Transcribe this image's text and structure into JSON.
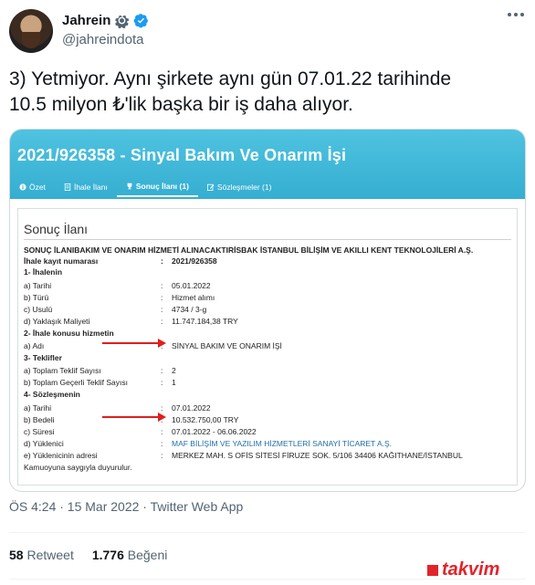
{
  "author": {
    "name": "Jahrein",
    "handle": "@jahreindota"
  },
  "tweet": {
    "line1": "3) Yetmiyor. Aynı şirkete aynı gün 07.01.22 tarihinde",
    "line2": "10.5 milyon ₺'lik başka bir iş daha alıyor.",
    "timestamp": "ÖS 4:24 · 15 Mar 2022 · Twitter Web App"
  },
  "stats": {
    "retweets_count": "58",
    "retweets_label": "Retweet",
    "likes_count": "1.776",
    "likes_label": "Beğeni"
  },
  "ihale": {
    "title": "2021/926358 - Sinyal Bakım Ve Onarım İşi",
    "tabs": [
      "Özet",
      "İhale İlanı",
      "Sonuç İlanı (1)",
      "Sözleşmeler (1)"
    ],
    "doc_title": "Sonuç İlanı",
    "header_line": "SONUÇ İLANIBAKIM VE ONARIM HİZMETİ ALINACAKTIRİSBAK İSTANBUL BİLİŞİM VE AKILLI KENT TEKNOLOJİLERİ A.Ş.",
    "kayit_label": "İhale kayıt numarası",
    "kayit_value": "2021/926358",
    "sec1": "1- İhalenin",
    "tarih_label": "a) Tarihi",
    "tarih_value": "05.01.2022",
    "turu_label": "b) Türü",
    "turu_value": "Hizmet alımı",
    "usulu_label": "c) Usulü",
    "usulu_value": "4734 / 3-g",
    "maliyet_label": "d) Yaklaşık Maliyeti",
    "maliyet_value": "11.747.184,38 TRY",
    "sec2": "2- İhale konusu hizmetin",
    "adi_label": "a) Adı",
    "adi_value": "SİNYAL BAKIM VE ONARIM İŞİ",
    "sec3": "3- Teklifler",
    "teklif_label": "a) Toplam Teklif Sayısı",
    "teklif_value": "2",
    "gecerli_label": "b) Toplam Geçerli Teklif Sayısı",
    "gecerli_value": "1",
    "sec4": "4- Sözleşmenin",
    "s_tarih_label": "a) Tarihi",
    "s_tarih_value": "07.01.2022",
    "bedel_label": "b) Bedeli",
    "bedel_value": "10.532.750,00 TRY",
    "suresi_label": "c) Süresi",
    "suresi_value": "07.01.2022 - 06.06.2022",
    "yuklenici_label": "d) Yüklenici",
    "yuklenici_value": "MAF BİLİŞİM VE YAZILIM HİZMETLERİ SANAYİ TİCARET A.Ş.",
    "adres_label": "e) Yüklenicinin adresi",
    "adres_value": "MERKEZ MAH. S OFİS SİTESİ FİRUZE SOK. 5/106 34406 KAĞITHANE/İSTANBUL",
    "footer": "Kamuoyuna saygıyla duyurulur."
  },
  "colors": {
    "verified": "#1d9bf0",
    "banner": "#35aed1",
    "arrow": "#e11d1d"
  },
  "watermark": "takvim"
}
